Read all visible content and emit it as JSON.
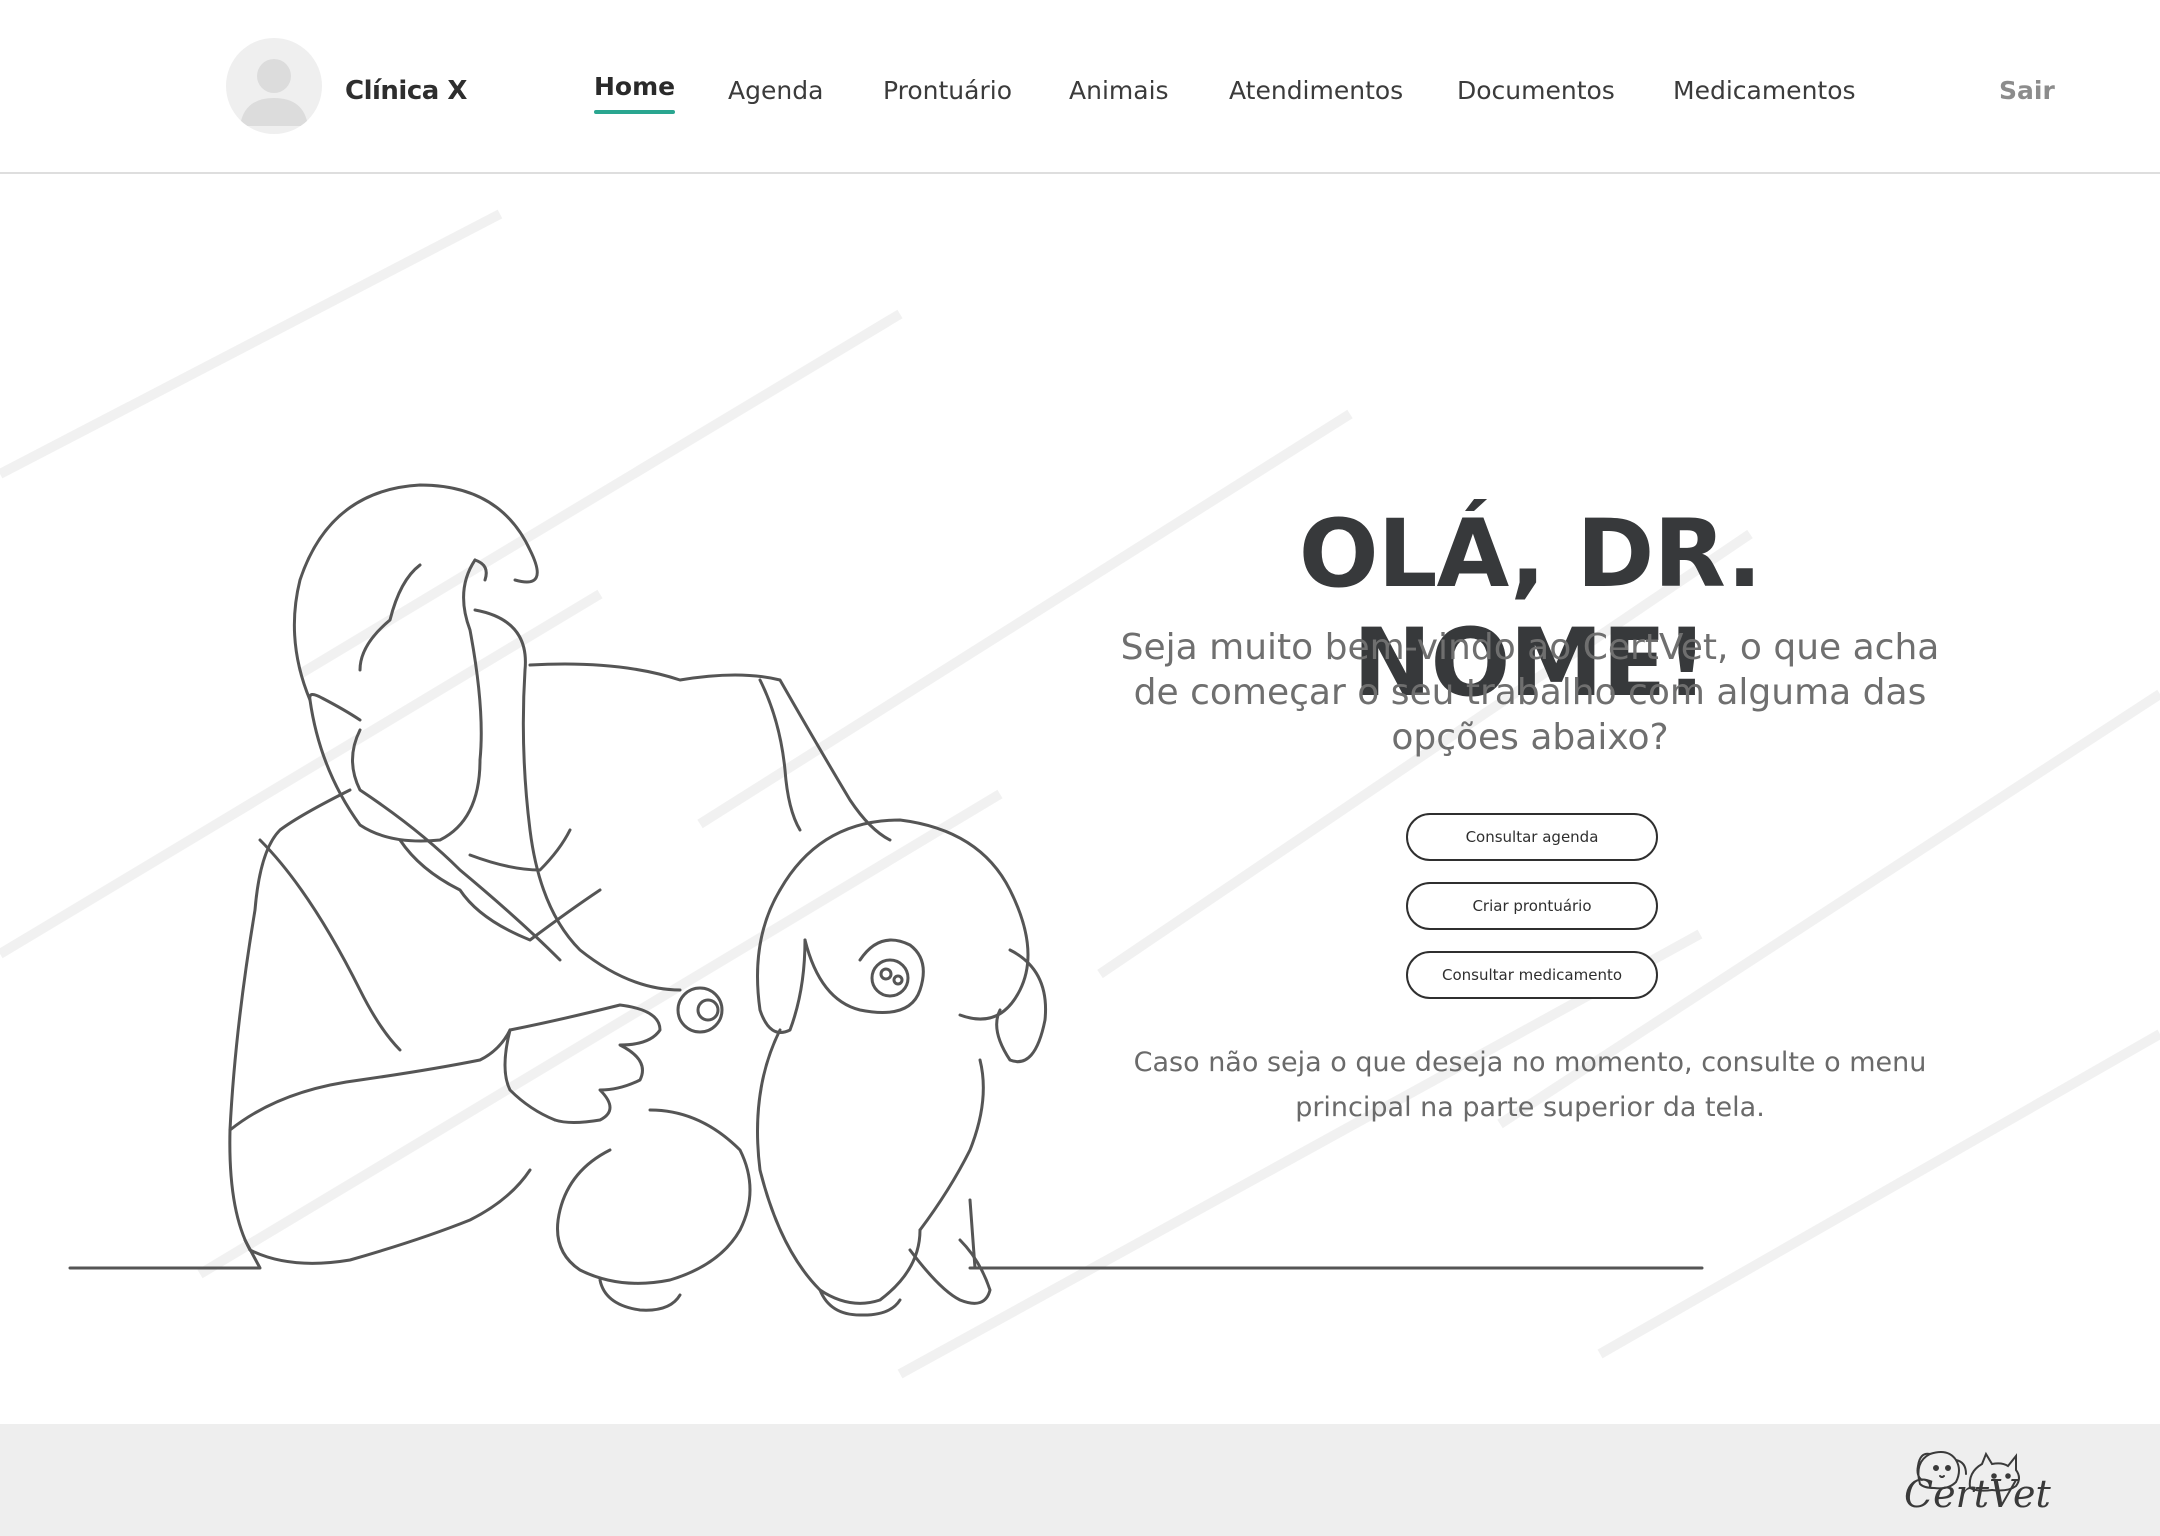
{
  "header": {
    "brand": "Clínica X",
    "nav": [
      {
        "label": "Home",
        "active": true
      },
      {
        "label": "Agenda"
      },
      {
        "label": "Prontuário"
      },
      {
        "label": "Animais"
      },
      {
        "label": "Atendimentos"
      },
      {
        "label": "Documentos"
      },
      {
        "label": "Medicamentos"
      }
    ],
    "logout": "Sair"
  },
  "hero": {
    "title": "OLÁ, DR. NOME!",
    "subtitle": "Seja muito bem-vindo ao CertVet, o que acha de começar o seu trabalho com alguma das opções abaixo?",
    "buttons": [
      "Consultar agenda",
      "Criar prontuário",
      "Consultar medicamento"
    ],
    "note": "Caso não seja o que deseja no momento, consulte o menu principal na parte superior da tela."
  },
  "footer": {
    "logo_text": "CertVet"
  },
  "colors": {
    "accent": "#2aa690",
    "text_dark": "#37393b",
    "text_muted": "#6f6f6f",
    "footer_bg": "#eeeeee"
  },
  "icons": {
    "avatar": "user-avatar-icon",
    "illustration": "vet-with-puppy-line-art",
    "logo": "dog-cat-logo-icon"
  }
}
